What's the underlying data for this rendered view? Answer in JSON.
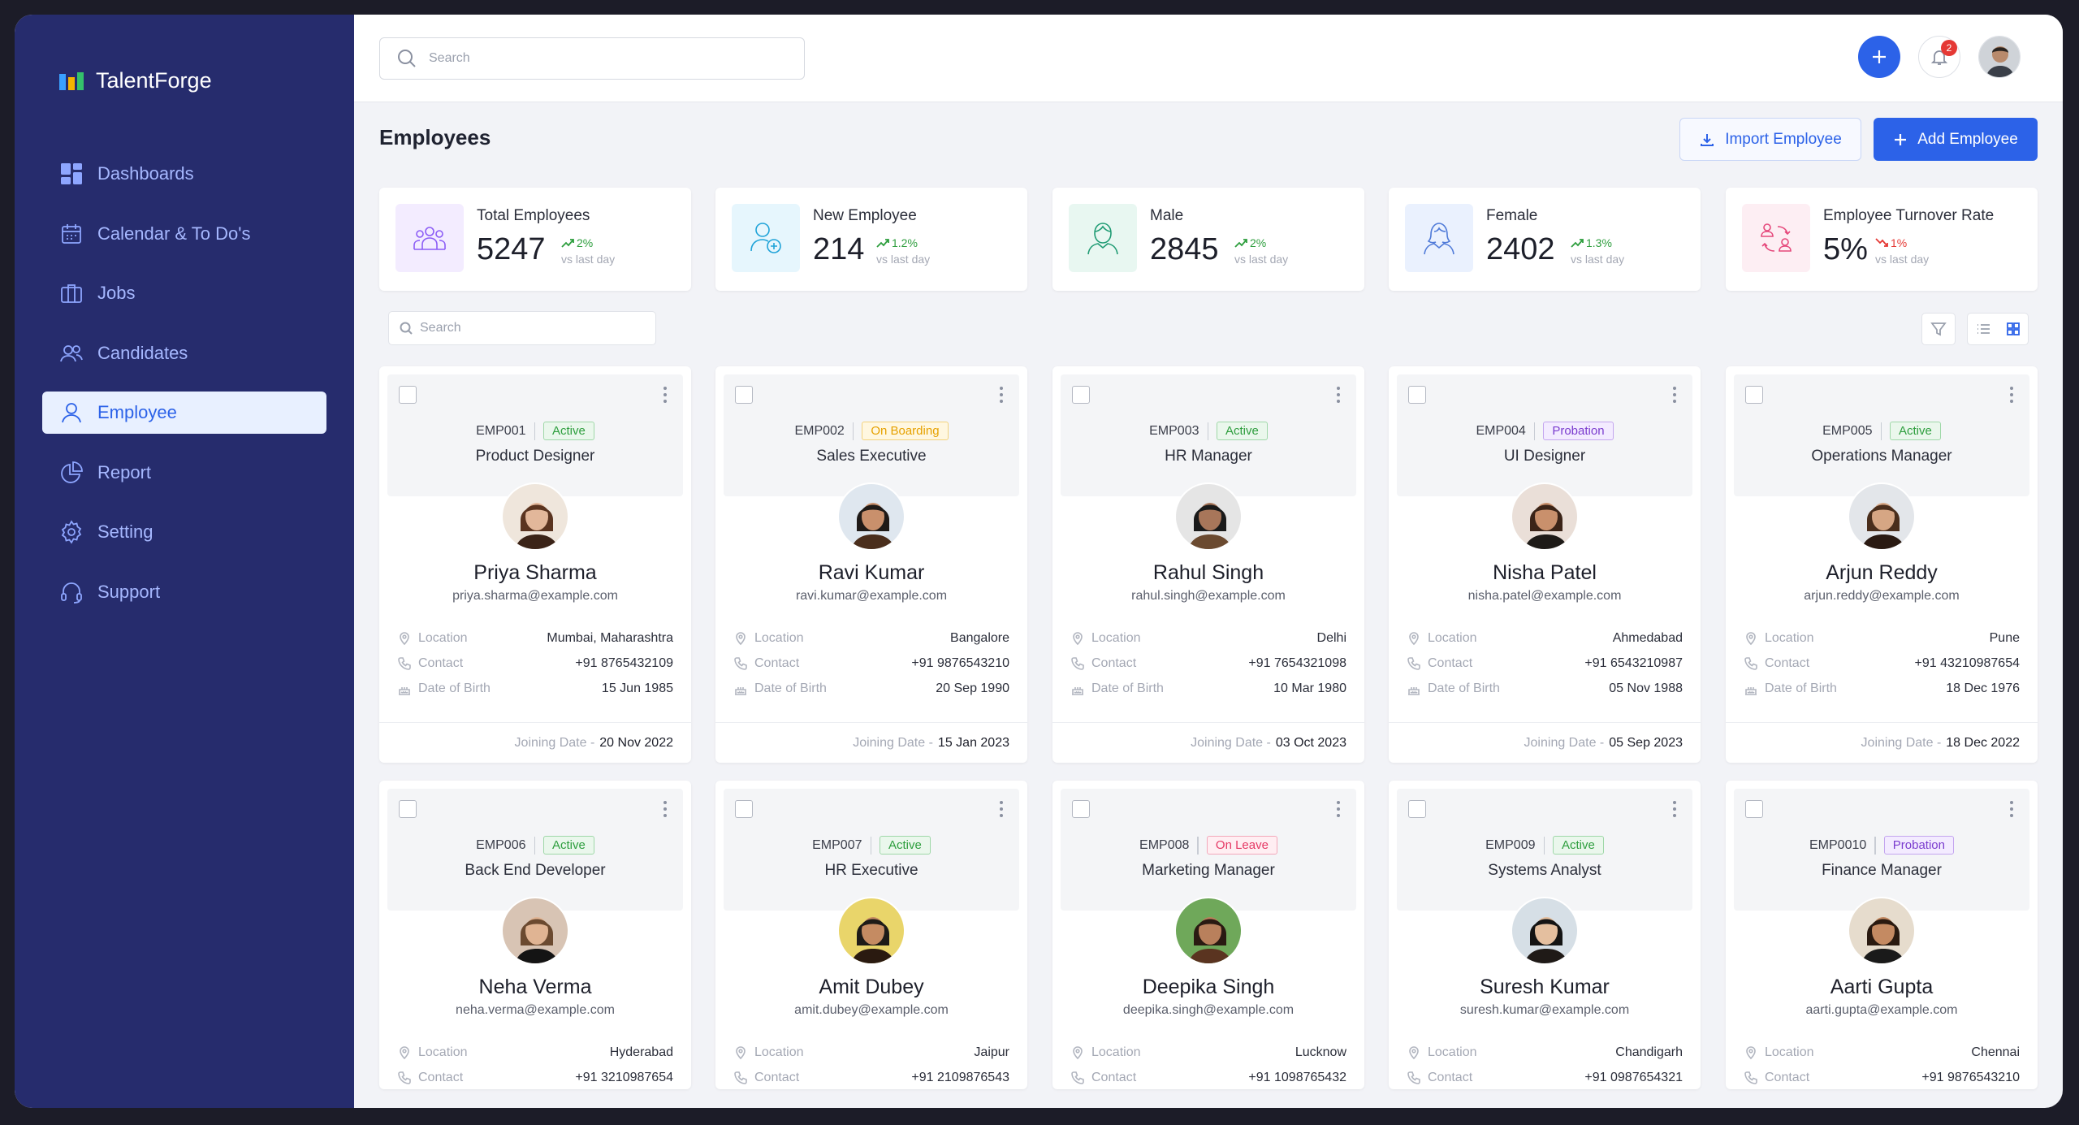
{
  "app": {
    "name": "TalentForge"
  },
  "sidebar": {
    "items": [
      {
        "label": "Dashboards",
        "icon": "dashboard-icon"
      },
      {
        "label": "Calendar & To Do's",
        "icon": "calendar-icon"
      },
      {
        "label": "Jobs",
        "icon": "briefcase-icon"
      },
      {
        "label": "Candidates",
        "icon": "users-icon"
      },
      {
        "label": "Employee",
        "icon": "user-icon",
        "active": true
      },
      {
        "label": "Report",
        "icon": "pie-chart-icon"
      },
      {
        "label": "Setting",
        "icon": "gear-icon"
      },
      {
        "label": "Support",
        "icon": "headset-icon"
      }
    ]
  },
  "topbar": {
    "search_placeholder": "Search",
    "notification_count": "2"
  },
  "page": {
    "title": "Employees",
    "import_label": "Import Employee",
    "add_label": "Add Employee"
  },
  "stats": [
    {
      "label": "Total Employees",
      "value": "5247",
      "trend": "2%",
      "direction": "up",
      "vs": "vs last day"
    },
    {
      "label": "New Employee",
      "value": "214",
      "trend": "1.2%",
      "direction": "up",
      "vs": "vs last day"
    },
    {
      "label": "Male",
      "value": "2845",
      "trend": "2%",
      "direction": "up",
      "vs": "vs last day"
    },
    {
      "label": "Female",
      "value": "2402",
      "trend": "1.3%",
      "direction": "up",
      "vs": "vs last day"
    },
    {
      "label": "Employee Turnover Rate",
      "value": "5%",
      "trend": "1%",
      "direction": "down",
      "vs": "vs last day"
    }
  ],
  "list": {
    "search_placeholder": "Search"
  },
  "field_labels": {
    "location": "Location",
    "contact": "Contact",
    "dob": "Date of Birth",
    "joining": "Joining Date -"
  },
  "employees": [
    {
      "id": "EMP001",
      "status": "Active",
      "role": "Product Designer",
      "name": "Priya Sharma",
      "email": "priya.sharma@example.com",
      "location": "Mumbai, Maharashtra",
      "contact": "+91 8765432109",
      "dob": "15 Jun 1985",
      "joining": "20 Nov 2022"
    },
    {
      "id": "EMP002",
      "status": "On Boarding",
      "role": "Sales Executive",
      "name": "Ravi Kumar",
      "email": "ravi.kumar@example.com",
      "location": "Bangalore",
      "contact": "+91 9876543210",
      "dob": "20 Sep 1990",
      "joining": "15 Jan 2023"
    },
    {
      "id": "EMP003",
      "status": "Active",
      "role": "HR Manager",
      "name": "Rahul Singh",
      "email": "rahul.singh@example.com",
      "location": "Delhi",
      "contact": "+91 7654321098",
      "dob": "10 Mar 1980",
      "joining": "03 Oct 2023"
    },
    {
      "id": "EMP004",
      "status": "Probation",
      "role": "UI Designer",
      "name": "Nisha Patel",
      "email": "nisha.patel@example.com",
      "location": "Ahmedabad",
      "contact": "+91 6543210987",
      "dob": "05 Nov 1988",
      "joining": "05 Sep 2023"
    },
    {
      "id": "EMP005",
      "status": "Active",
      "role": "Operations Manager",
      "name": "Arjun Reddy",
      "email": "arjun.reddy@example.com",
      "location": "Pune",
      "contact": "+91 43210987654",
      "dob": "18 Dec 1976",
      "joining": "18 Dec 2022"
    },
    {
      "id": "EMP006",
      "status": "Active",
      "role": "Back End Developer",
      "name": "Neha Verma",
      "email": "neha.verma@example.com",
      "location": "Hyderabad",
      "contact": "+91 3210987654"
    },
    {
      "id": "EMP007",
      "status": "Active",
      "role": "HR Executive",
      "name": "Amit Dubey",
      "email": "amit.dubey@example.com",
      "location": "Jaipur",
      "contact": "+91 2109876543"
    },
    {
      "id": "EMP008",
      "status": "On Leave",
      "role": "Marketing Manager",
      "name": "Deepika Singh",
      "email": "deepika.singh@example.com",
      "location": "Lucknow",
      "contact": "+91 1098765432"
    },
    {
      "id": "EMP009",
      "status": "Active",
      "role": "Systems Analyst",
      "name": "Suresh Kumar",
      "email": "suresh.kumar@example.com",
      "location": "Chandigarh",
      "contact": "+91 0987654321"
    },
    {
      "id": "EMP0010",
      "status": "Probation",
      "role": "Finance Manager",
      "name": "Aarti Gupta",
      "email": "aarti.gupta@example.com",
      "location": "Chennai",
      "contact": "+91 9876543210"
    }
  ],
  "colors": {
    "sidebar": "#262c6d",
    "accent": "#2c62e8",
    "active": "#2e9e3e",
    "onboarding": "#e6a100",
    "probation": "#7b3ccf",
    "onleave": "#e53965"
  }
}
